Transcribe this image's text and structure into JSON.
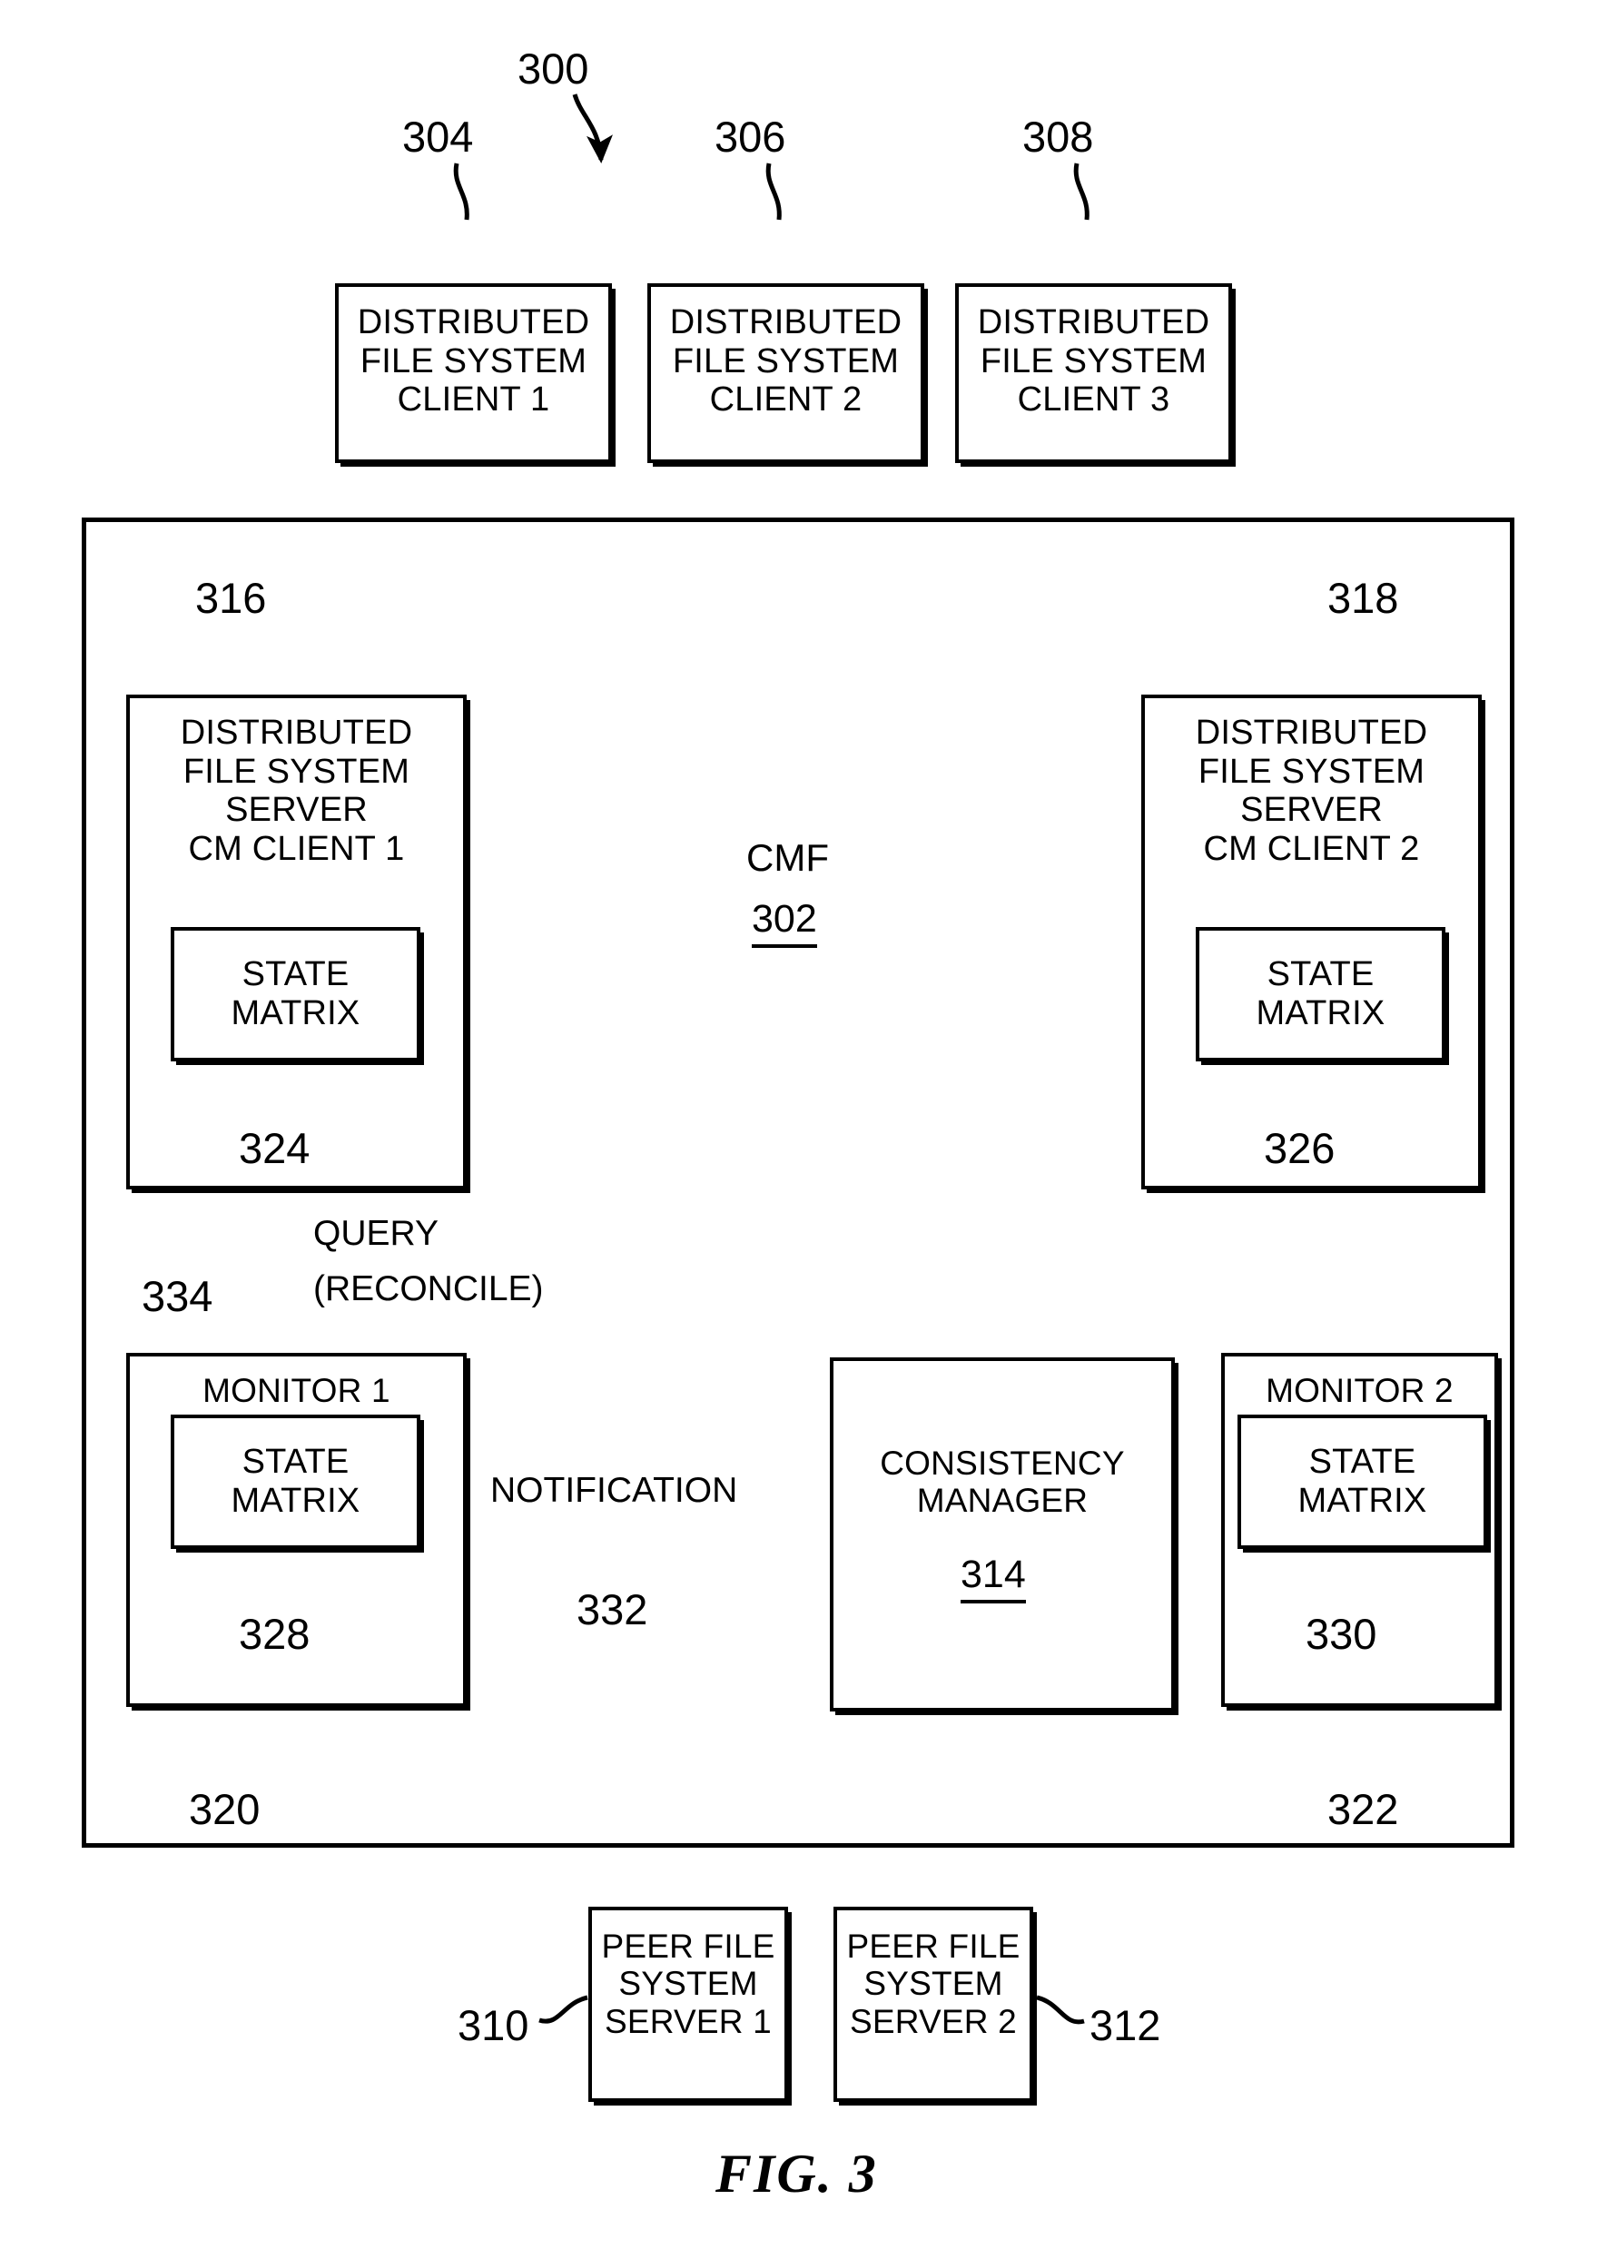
{
  "figure": {
    "caption": "FIG. 3",
    "system_ref": "300"
  },
  "clients": [
    {
      "ref": "304",
      "lines": [
        "DISTRIBUTED",
        "FILE SYSTEM",
        "CLIENT 1"
      ]
    },
    {
      "ref": "306",
      "lines": [
        "DISTRIBUTED",
        "FILE SYSTEM",
        "CLIENT 2"
      ]
    },
    {
      "ref": "308",
      "lines": [
        "DISTRIBUTED",
        "FILE SYSTEM",
        "CLIENT 3"
      ]
    }
  ],
  "cmf": {
    "label": "CMF",
    "ref": "302"
  },
  "servers": [
    {
      "ref": "316",
      "lines": [
        "DISTRIBUTED",
        "FILE SYSTEM",
        "SERVER",
        "CM CLIENT 1"
      ],
      "state_matrix": {
        "lines": [
          "STATE",
          "MATRIX"
        ],
        "ref": "324"
      }
    },
    {
      "ref": "318",
      "lines": [
        "DISTRIBUTED",
        "FILE SYSTEM",
        "SERVER",
        "CM CLIENT 2"
      ],
      "state_matrix": {
        "lines": [
          "STATE",
          "MATRIX"
        ],
        "ref": "326"
      }
    }
  ],
  "monitors": [
    {
      "ref": "320",
      "title": "MONITOR 1",
      "state_matrix": {
        "lines": [
          "STATE",
          "MATRIX"
        ],
        "ref": "328"
      }
    },
    {
      "ref": "322",
      "title": "MONITOR 2",
      "state_matrix": {
        "lines": [
          "STATE",
          "MATRIX"
        ],
        "ref": "330"
      }
    }
  ],
  "consistency_manager": {
    "lines": [
      "CONSISTENCY",
      "MANAGER"
    ],
    "ref": "314"
  },
  "flows": [
    {
      "ref": "334",
      "lines": [
        "QUERY",
        "(RECONCILE)"
      ]
    },
    {
      "ref": "332",
      "lines": [
        "NOTIFICATION"
      ]
    }
  ],
  "peers": [
    {
      "ref": "310",
      "lines": [
        "PEER FILE",
        "SYSTEM",
        "SERVER 1"
      ]
    },
    {
      "ref": "312",
      "lines": [
        "PEER FILE",
        "SYSTEM",
        "SERVER 2"
      ]
    }
  ],
  "colors": {
    "ink": "#000000",
    "paper": "#ffffff"
  }
}
